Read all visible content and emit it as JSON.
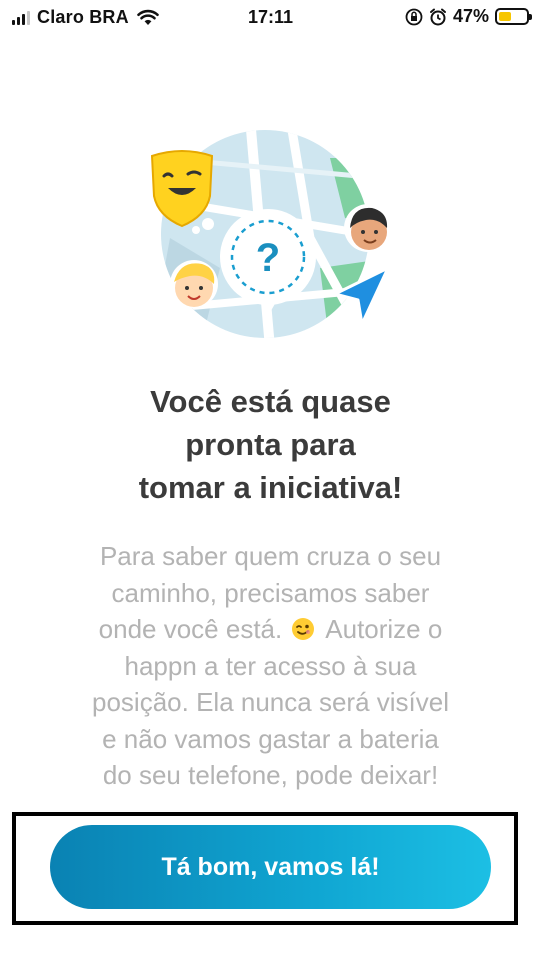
{
  "status_bar": {
    "carrier": "Claro BRA",
    "time": "17:11",
    "battery_percent": "47%",
    "battery_level": 0.47,
    "signal_bars_active": 3,
    "signal_bars_total": 4,
    "icons": [
      "wifi-icon",
      "orientation-lock-icon",
      "alarm-icon",
      "battery-icon"
    ]
  },
  "onboarding": {
    "title_lines": [
      "Você está quase",
      "pronta para",
      "tomar a iniciativa!"
    ],
    "body_lines": [
      "Para saber quem cruza o seu",
      "caminho, precisamos saber",
      "onde você está.",
      "Autorize o",
      "happn a ter acesso à sua",
      "posição. Ela nunca será visível",
      "e não vamos gastar a bateria",
      "do seu telefone, pode deixar!"
    ],
    "illustration_marker": "?",
    "button_label": "Tá bom, vamos lá!"
  },
  "colors": {
    "button_gradient_start": "#0a82b3",
    "button_gradient_end": "#1cbfe4",
    "title": "#3b3b3b",
    "body": "#b3b3b3",
    "battery_fill": "#f7c600"
  }
}
